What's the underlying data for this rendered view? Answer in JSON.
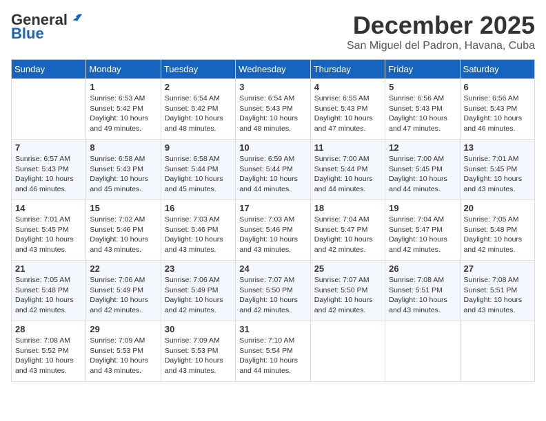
{
  "header": {
    "logo_general": "General",
    "logo_blue": "Blue",
    "month_title": "December 2025",
    "location": "San Miguel del Padron, Havana, Cuba"
  },
  "days_of_week": [
    "Sunday",
    "Monday",
    "Tuesday",
    "Wednesday",
    "Thursday",
    "Friday",
    "Saturday"
  ],
  "weeks": [
    [
      {
        "day": "",
        "info": ""
      },
      {
        "day": "1",
        "info": "Sunrise: 6:53 AM\nSunset: 5:42 PM\nDaylight: 10 hours\nand 49 minutes."
      },
      {
        "day": "2",
        "info": "Sunrise: 6:54 AM\nSunset: 5:42 PM\nDaylight: 10 hours\nand 48 minutes."
      },
      {
        "day": "3",
        "info": "Sunrise: 6:54 AM\nSunset: 5:43 PM\nDaylight: 10 hours\nand 48 minutes."
      },
      {
        "day": "4",
        "info": "Sunrise: 6:55 AM\nSunset: 5:43 PM\nDaylight: 10 hours\nand 47 minutes."
      },
      {
        "day": "5",
        "info": "Sunrise: 6:56 AM\nSunset: 5:43 PM\nDaylight: 10 hours\nand 47 minutes."
      },
      {
        "day": "6",
        "info": "Sunrise: 6:56 AM\nSunset: 5:43 PM\nDaylight: 10 hours\nand 46 minutes."
      }
    ],
    [
      {
        "day": "7",
        "info": "Sunrise: 6:57 AM\nSunset: 5:43 PM\nDaylight: 10 hours\nand 46 minutes."
      },
      {
        "day": "8",
        "info": "Sunrise: 6:58 AM\nSunset: 5:43 PM\nDaylight: 10 hours\nand 45 minutes."
      },
      {
        "day": "9",
        "info": "Sunrise: 6:58 AM\nSunset: 5:44 PM\nDaylight: 10 hours\nand 45 minutes."
      },
      {
        "day": "10",
        "info": "Sunrise: 6:59 AM\nSunset: 5:44 PM\nDaylight: 10 hours\nand 44 minutes."
      },
      {
        "day": "11",
        "info": "Sunrise: 7:00 AM\nSunset: 5:44 PM\nDaylight: 10 hours\nand 44 minutes."
      },
      {
        "day": "12",
        "info": "Sunrise: 7:00 AM\nSunset: 5:45 PM\nDaylight: 10 hours\nand 44 minutes."
      },
      {
        "day": "13",
        "info": "Sunrise: 7:01 AM\nSunset: 5:45 PM\nDaylight: 10 hours\nand 43 minutes."
      }
    ],
    [
      {
        "day": "14",
        "info": "Sunrise: 7:01 AM\nSunset: 5:45 PM\nDaylight: 10 hours\nand 43 minutes."
      },
      {
        "day": "15",
        "info": "Sunrise: 7:02 AM\nSunset: 5:46 PM\nDaylight: 10 hours\nand 43 minutes."
      },
      {
        "day": "16",
        "info": "Sunrise: 7:03 AM\nSunset: 5:46 PM\nDaylight: 10 hours\nand 43 minutes."
      },
      {
        "day": "17",
        "info": "Sunrise: 7:03 AM\nSunset: 5:46 PM\nDaylight: 10 hours\nand 43 minutes."
      },
      {
        "day": "18",
        "info": "Sunrise: 7:04 AM\nSunset: 5:47 PM\nDaylight: 10 hours\nand 42 minutes."
      },
      {
        "day": "19",
        "info": "Sunrise: 7:04 AM\nSunset: 5:47 PM\nDaylight: 10 hours\nand 42 minutes."
      },
      {
        "day": "20",
        "info": "Sunrise: 7:05 AM\nSunset: 5:48 PM\nDaylight: 10 hours\nand 42 minutes."
      }
    ],
    [
      {
        "day": "21",
        "info": "Sunrise: 7:05 AM\nSunset: 5:48 PM\nDaylight: 10 hours\nand 42 minutes."
      },
      {
        "day": "22",
        "info": "Sunrise: 7:06 AM\nSunset: 5:49 PM\nDaylight: 10 hours\nand 42 minutes."
      },
      {
        "day": "23",
        "info": "Sunrise: 7:06 AM\nSunset: 5:49 PM\nDaylight: 10 hours\nand 42 minutes."
      },
      {
        "day": "24",
        "info": "Sunrise: 7:07 AM\nSunset: 5:50 PM\nDaylight: 10 hours\nand 42 minutes."
      },
      {
        "day": "25",
        "info": "Sunrise: 7:07 AM\nSunset: 5:50 PM\nDaylight: 10 hours\nand 42 minutes."
      },
      {
        "day": "26",
        "info": "Sunrise: 7:08 AM\nSunset: 5:51 PM\nDaylight: 10 hours\nand 43 minutes."
      },
      {
        "day": "27",
        "info": "Sunrise: 7:08 AM\nSunset: 5:51 PM\nDaylight: 10 hours\nand 43 minutes."
      }
    ],
    [
      {
        "day": "28",
        "info": "Sunrise: 7:08 AM\nSunset: 5:52 PM\nDaylight: 10 hours\nand 43 minutes."
      },
      {
        "day": "29",
        "info": "Sunrise: 7:09 AM\nSunset: 5:53 PM\nDaylight: 10 hours\nand 43 minutes."
      },
      {
        "day": "30",
        "info": "Sunrise: 7:09 AM\nSunset: 5:53 PM\nDaylight: 10 hours\nand 43 minutes."
      },
      {
        "day": "31",
        "info": "Sunrise: 7:10 AM\nSunset: 5:54 PM\nDaylight: 10 hours\nand 44 minutes."
      },
      {
        "day": "",
        "info": ""
      },
      {
        "day": "",
        "info": ""
      },
      {
        "day": "",
        "info": ""
      }
    ]
  ]
}
